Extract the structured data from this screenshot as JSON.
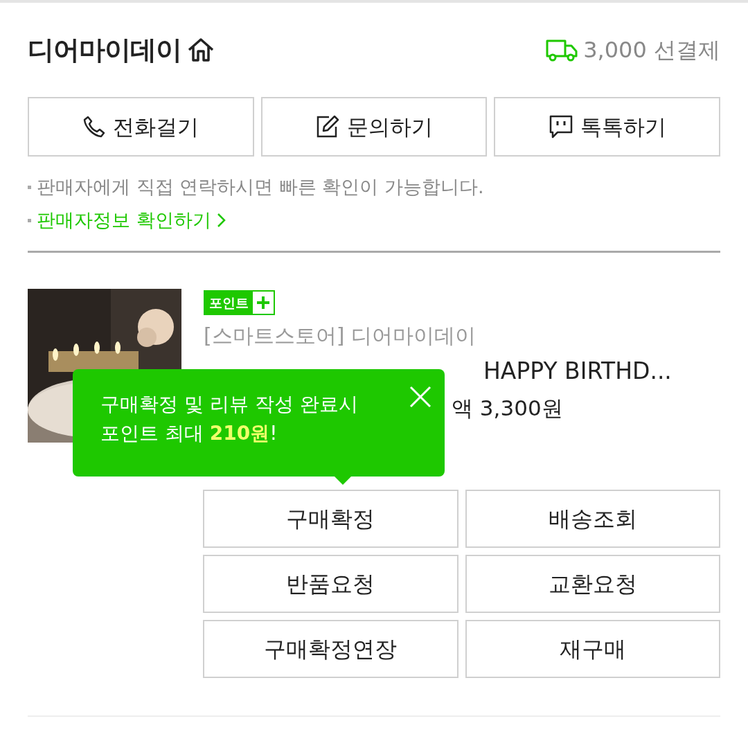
{
  "seller": {
    "name": "디어마이데이",
    "shipping_fee": "3,000",
    "shipping_mode": "선결제"
  },
  "contact_buttons": [
    {
      "kind": "phone",
      "label": "전화걸기"
    },
    {
      "kind": "inquiry",
      "label": "문의하기"
    },
    {
      "kind": "talk",
      "label": "톡톡하기"
    }
  ],
  "notes": [
    {
      "kind": "plain",
      "text": "판매자에게 직접 연락하시면 빠른 확인이 가능합니다."
    },
    {
      "kind": "link",
      "text": "판매자정보 확인하기"
    }
  ],
  "order": {
    "badge": "포인트",
    "store": "[스마트스토어] 디어마이데이",
    "title": "HAPPY BIRTHD...",
    "price": "액 3,300원"
  },
  "tooltip": {
    "text": "구매확정 및 리뷰 작성 완료시\n포인트 최대 **210원**!"
  },
  "actions": [
    "구매확정",
    "배송조회",
    "반품요청",
    "교환요청",
    "구매확정연장",
    "재구매"
  ]
}
